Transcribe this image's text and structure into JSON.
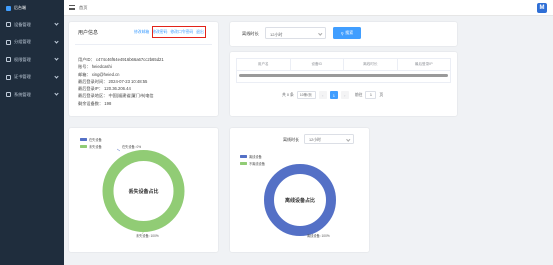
{
  "sidebar": {
    "brand": "后台端",
    "items": [
      {
        "label": "设备管理"
      },
      {
        "label": "分组管理"
      },
      {
        "label": "权限管理"
      },
      {
        "label": "证书管理"
      },
      {
        "label": "系统管理"
      }
    ]
  },
  "topbar": {
    "crumb": "首页",
    "logo_glyph": "M"
  },
  "user": {
    "title": "用户信息",
    "links": [
      "修改邮箱",
      "修改密码",
      "修改口令密码",
      "退出"
    ],
    "uid": "用户ID：  c474c46f64e4916b66a67cc2b65d21",
    "account": "账号：  heiedcashi",
    "email": "邮箱：  xing@heied.cn",
    "last_login_time": "最后登录时间：  2024-07-23 10:48:55",
    "last_login_ip": "最后登录IP：  120.36.206.44",
    "last_login_area": "最后登录地区：  中国|福建省|厦门市|电信",
    "device_count": "剩余设备数：  198"
  },
  "search": {
    "label": "离线时长",
    "select_value": "12小时",
    "button": "搜索"
  },
  "table": {
    "columns": [
      "用户名",
      "设备ID",
      "离线时长",
      "最后登录IP"
    ]
  },
  "pagination": {
    "total": "共 0 条",
    "page_size": "10条/页",
    "current": "1",
    "goto_label": "前往",
    "goto_value": "1",
    "page_unit": "页"
  },
  "chart_left": {
    "legend": [
      "在失设备",
      "未失设备"
    ],
    "center_label": "丢失设备占比",
    "callout_top": "在失设备: 0%",
    "callout_bottom": "未失设备: 100%"
  },
  "chart_right": {
    "filter_label": "离线时长",
    "filter_value": "12小时",
    "legend": [
      "离线设备",
      "不离线设备"
    ],
    "center_label": "离线设备占比",
    "callout_bottom": "离线设备: 100%"
  },
  "chart_data": [
    {
      "type": "pie",
      "title": "丢失设备占比",
      "categories": [
        "在失设备",
        "未失设备"
      ],
      "values": [
        0,
        100
      ],
      "colors": [
        "#5470c6",
        "#91cc75"
      ]
    },
    {
      "type": "pie",
      "title": "离线设备占比",
      "categories": [
        "离线设备",
        "不离线设备"
      ],
      "values": [
        100,
        0
      ],
      "colors": [
        "#5470c6",
        "#91cc75"
      ]
    }
  ],
  "colors": {
    "primary": "#409eff",
    "sidebar_bg": "#1f2d3d",
    "highlight": "#e2231a",
    "series_blue": "#5470c6",
    "series_green": "#91cc75"
  }
}
